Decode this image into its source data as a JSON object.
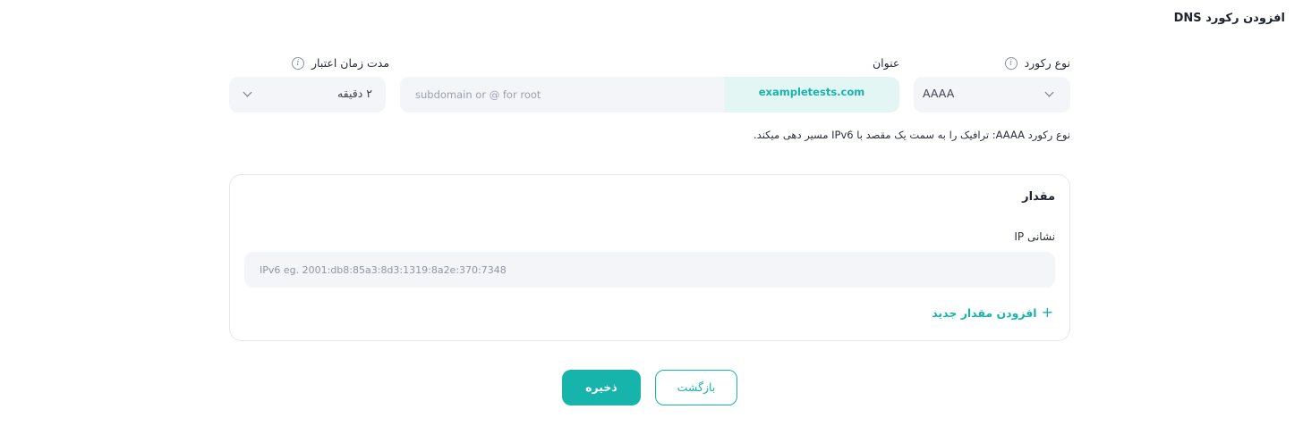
{
  "page": {
    "title": "افزودن رکورد DNS"
  },
  "fields": {
    "type": {
      "label": "نوع رکورد",
      "value": "AAAA"
    },
    "name": {
      "label": "عنوان",
      "placeholder": "subdomain or @ for root",
      "suffix": "exampletests.com"
    },
    "ttl": {
      "label": "مدت زمان اعتبار",
      "value": "۲ دقیقه"
    }
  },
  "hint": "نوع رکورد AAAA: ترافیک را به سمت یک مقصد با IPv6 مسیر دهی میکند.",
  "value_card": {
    "title": "مقدار",
    "ip_label": "نشانی IP",
    "ip_placeholder": "IPv6 eg. 2001:db8:85a3:8d3:1319:8a2e:370:7348",
    "add_label": "افزودن مقدار جدید",
    "add_icon": "+"
  },
  "buttons": {
    "back": "بازگشت",
    "save": "ذخیره"
  },
  "icons": {
    "info": "i"
  },
  "colors": {
    "accent": "#17b4ac",
    "accent_light": "#e3f6f4",
    "field_bg": "#f3f5f9"
  }
}
